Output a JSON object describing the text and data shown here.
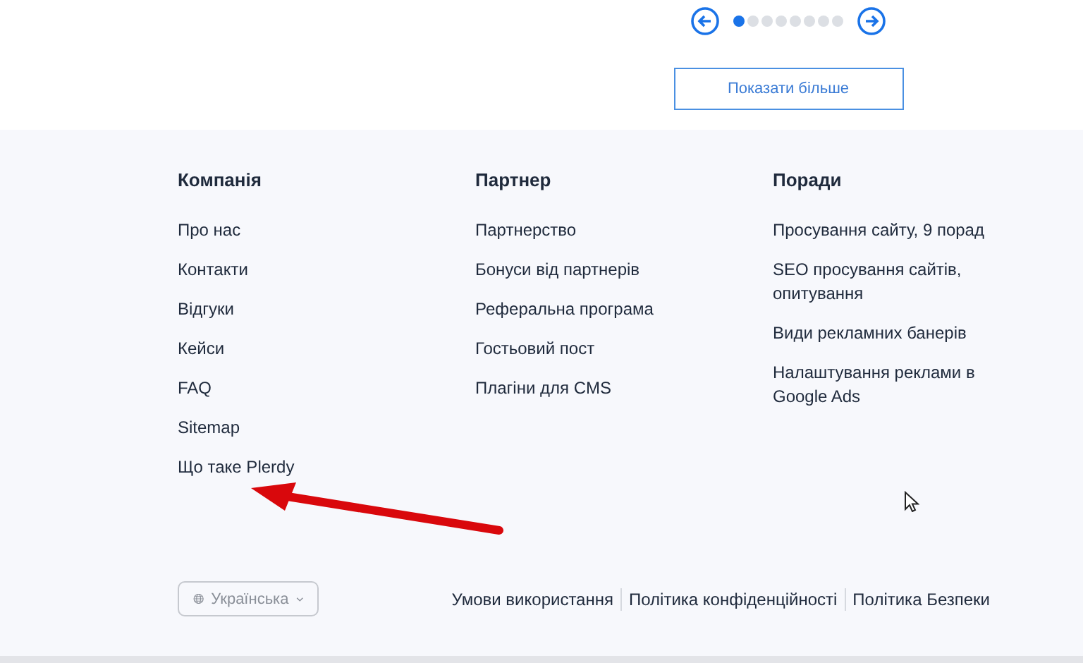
{
  "carousel": {
    "dots": [
      {
        "selected": true
      },
      {
        "selected": false
      },
      {
        "selected": false
      },
      {
        "selected": false
      },
      {
        "selected": false
      },
      {
        "selected": false
      },
      {
        "selected": false
      },
      {
        "selected": false
      }
    ],
    "more_button": "Показати більше"
  },
  "footer": {
    "columns": [
      {
        "title": "Компанія",
        "links": [
          "Про нас",
          "Контакти",
          "Відгуки",
          "Кейси",
          "FAQ",
          "Sitemap",
          "Що таке Plerdy"
        ]
      },
      {
        "title": "Партнер",
        "links": [
          "Партнерство",
          "Бонуси від партнерів",
          "Реферальна програма",
          "Гостьовий пост",
          "Плагіни для CMS"
        ]
      },
      {
        "title": "Поради",
        "links": [
          "Просування сайту, 9 порад",
          "SEO просування сайтів, опитування",
          "Види рекламних банерів",
          "Налаштування реклами в Google Ads"
        ]
      }
    ],
    "language": "Українська",
    "legal_links": [
      "Умови використання",
      "Політика конфіденційності",
      "Політика Безпеки"
    ]
  }
}
